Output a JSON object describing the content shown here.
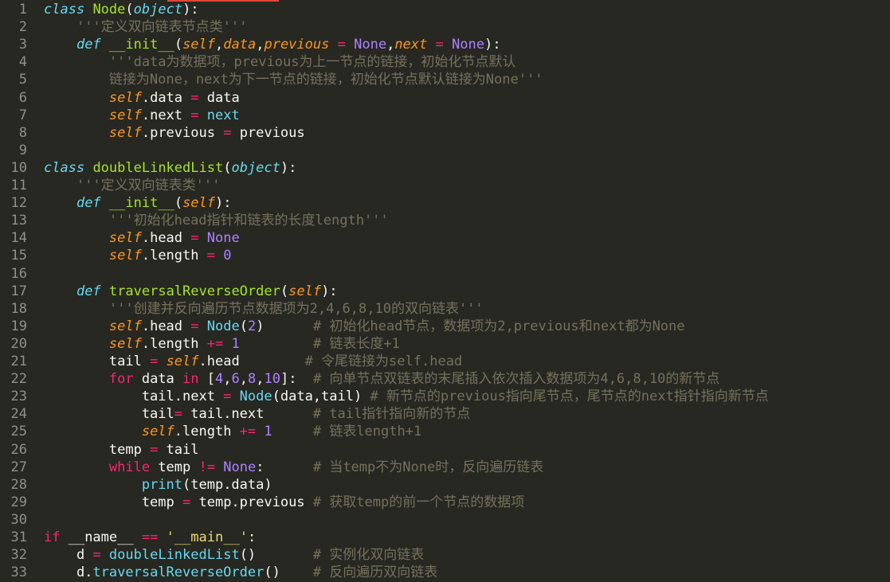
{
  "editor": {
    "lines": [
      {
        "n": "1",
        "tokens": [
          [
            "kw",
            "class"
          ],
          [
            "txt",
            " "
          ],
          [
            "cls",
            "Node"
          ],
          [
            "txt",
            "("
          ],
          [
            "kw",
            "object"
          ],
          [
            "txt",
            "):"
          ]
        ]
      },
      {
        "n": "2",
        "tokens": [
          [
            "txt",
            "    "
          ],
          [
            "doc",
            "'''定义双向链表节点类'''"
          ]
        ]
      },
      {
        "n": "3",
        "tokens": [
          [
            "txt",
            "    "
          ],
          [
            "kw",
            "def"
          ],
          [
            "txt",
            " "
          ],
          [
            "fn",
            "__init__"
          ],
          [
            "txt",
            "("
          ],
          [
            "arg",
            "self"
          ],
          [
            "txt",
            ","
          ],
          [
            "arg",
            "data"
          ],
          [
            "txt",
            ","
          ],
          [
            "arg",
            "previous"
          ],
          [
            "txt",
            " "
          ],
          [
            "op",
            "="
          ],
          [
            "txt",
            " "
          ],
          [
            "const",
            "None"
          ],
          [
            "txt",
            ","
          ],
          [
            "arg",
            "next"
          ],
          [
            "txt",
            " "
          ],
          [
            "op",
            "="
          ],
          [
            "txt",
            " "
          ],
          [
            "const",
            "None"
          ],
          [
            "txt",
            "):"
          ]
        ]
      },
      {
        "n": "4",
        "tokens": [
          [
            "txt",
            "        "
          ],
          [
            "doc",
            "'''data为数据项，previous为上一节点的链接，初始化节点默认"
          ]
        ]
      },
      {
        "n": "5",
        "tokens": [
          [
            "txt",
            "        "
          ],
          [
            "doc",
            "链接为None，next为下一节点的链接，初始化节点默认链接为None'''"
          ]
        ]
      },
      {
        "n": "6",
        "tokens": [
          [
            "txt",
            "        "
          ],
          [
            "slf",
            "self"
          ],
          [
            "txt",
            ".data "
          ],
          [
            "op",
            "="
          ],
          [
            "txt",
            " data"
          ]
        ]
      },
      {
        "n": "7",
        "tokens": [
          [
            "txt",
            "        "
          ],
          [
            "slf",
            "self"
          ],
          [
            "txt",
            ".next "
          ],
          [
            "op",
            "="
          ],
          [
            "txt",
            " "
          ],
          [
            "bi",
            "next"
          ]
        ]
      },
      {
        "n": "8",
        "tokens": [
          [
            "txt",
            "        "
          ],
          [
            "slf",
            "self"
          ],
          [
            "txt",
            ".previous "
          ],
          [
            "op",
            "="
          ],
          [
            "txt",
            " previous"
          ]
        ]
      },
      {
        "n": "9",
        "tokens": []
      },
      {
        "n": "10",
        "tokens": [
          [
            "kw",
            "class"
          ],
          [
            "txt",
            " "
          ],
          [
            "cls",
            "doubleLinkedList"
          ],
          [
            "txt",
            "("
          ],
          [
            "kw",
            "object"
          ],
          [
            "txt",
            "):"
          ]
        ]
      },
      {
        "n": "11",
        "tokens": [
          [
            "txt",
            "    "
          ],
          [
            "doc",
            "'''定义双向链表类'''"
          ]
        ]
      },
      {
        "n": "12",
        "tokens": [
          [
            "txt",
            "    "
          ],
          [
            "kw",
            "def"
          ],
          [
            "txt",
            " "
          ],
          [
            "fn",
            "__init__"
          ],
          [
            "txt",
            "("
          ],
          [
            "arg",
            "self"
          ],
          [
            "txt",
            "):"
          ]
        ]
      },
      {
        "n": "13",
        "tokens": [
          [
            "txt",
            "        "
          ],
          [
            "doc",
            "'''初始化head指针和链表的长度length'''"
          ]
        ]
      },
      {
        "n": "14",
        "tokens": [
          [
            "txt",
            "        "
          ],
          [
            "slf",
            "self"
          ],
          [
            "txt",
            ".head "
          ],
          [
            "op",
            "="
          ],
          [
            "txt",
            " "
          ],
          [
            "const",
            "None"
          ]
        ]
      },
      {
        "n": "15",
        "tokens": [
          [
            "txt",
            "        "
          ],
          [
            "slf",
            "self"
          ],
          [
            "txt",
            ".length "
          ],
          [
            "op",
            "="
          ],
          [
            "txt",
            " "
          ],
          [
            "num",
            "0"
          ]
        ]
      },
      {
        "n": "16",
        "tokens": []
      },
      {
        "n": "17",
        "tokens": [
          [
            "txt",
            "    "
          ],
          [
            "kw",
            "def"
          ],
          [
            "txt",
            " "
          ],
          [
            "fn",
            "traversalReverseOrder"
          ],
          [
            "txt",
            "("
          ],
          [
            "arg",
            "self"
          ],
          [
            "txt",
            "):"
          ]
        ]
      },
      {
        "n": "18",
        "tokens": [
          [
            "txt",
            "        "
          ],
          [
            "doc",
            "'''创建并反向遍历节点数据项为2,4,6,8,10的双向链表'''"
          ]
        ]
      },
      {
        "n": "19",
        "tokens": [
          [
            "txt",
            "        "
          ],
          [
            "slf",
            "self"
          ],
          [
            "txt",
            ".head "
          ],
          [
            "op",
            "="
          ],
          [
            "txt",
            " "
          ],
          [
            "bi",
            "Node"
          ],
          [
            "txt",
            "("
          ],
          [
            "num",
            "2"
          ],
          [
            "txt",
            ")      "
          ],
          [
            "cmt",
            "# 初始化head节点，数据项为2,previous和next都为None"
          ]
        ]
      },
      {
        "n": "20",
        "tokens": [
          [
            "txt",
            "        "
          ],
          [
            "slf",
            "self"
          ],
          [
            "txt",
            ".length "
          ],
          [
            "op",
            "+="
          ],
          [
            "txt",
            " "
          ],
          [
            "num",
            "1"
          ],
          [
            "txt",
            "         "
          ],
          [
            "cmt",
            "# 链表长度+1"
          ]
        ]
      },
      {
        "n": "21",
        "tokens": [
          [
            "txt",
            "        tail "
          ],
          [
            "op",
            "="
          ],
          [
            "txt",
            " "
          ],
          [
            "slf",
            "self"
          ],
          [
            "txt",
            ".head        "
          ],
          [
            "cmt",
            "# 令尾链接为self.head"
          ]
        ]
      },
      {
        "n": "22",
        "tokens": [
          [
            "txt",
            "        "
          ],
          [
            "kw2",
            "for"
          ],
          [
            "txt",
            " data "
          ],
          [
            "kw2",
            "in"
          ],
          [
            "txt",
            " ["
          ],
          [
            "num",
            "4"
          ],
          [
            "txt",
            ","
          ],
          [
            "num",
            "6"
          ],
          [
            "txt",
            ","
          ],
          [
            "num",
            "8"
          ],
          [
            "txt",
            ","
          ],
          [
            "num",
            "10"
          ],
          [
            "txt",
            "]:  "
          ],
          [
            "cmt",
            "# 向单节点双链表的末尾插入依次插入数据项为4,6,8,10的新节点"
          ]
        ]
      },
      {
        "n": "23",
        "tokens": [
          [
            "txt",
            "            tail.next "
          ],
          [
            "op",
            "="
          ],
          [
            "txt",
            " "
          ],
          [
            "bi",
            "Node"
          ],
          [
            "txt",
            "(data,tail) "
          ],
          [
            "cmt",
            "# 新节点的previous指向尾节点，尾节点的next指针指向新节点"
          ]
        ]
      },
      {
        "n": "24",
        "tokens": [
          [
            "txt",
            "            tail"
          ],
          [
            "op",
            "="
          ],
          [
            "txt",
            " tail.next      "
          ],
          [
            "cmt",
            "# tail指针指向新的节点"
          ]
        ]
      },
      {
        "n": "25",
        "tokens": [
          [
            "txt",
            "            "
          ],
          [
            "slf",
            "self"
          ],
          [
            "txt",
            ".length "
          ],
          [
            "op",
            "+="
          ],
          [
            "txt",
            " "
          ],
          [
            "num",
            "1"
          ],
          [
            "txt",
            "     "
          ],
          [
            "cmt",
            "# 链表length+1"
          ]
        ]
      },
      {
        "n": "26",
        "tokens": [
          [
            "txt",
            "        temp "
          ],
          [
            "op",
            "="
          ],
          [
            "txt",
            " tail"
          ]
        ]
      },
      {
        "n": "27",
        "tokens": [
          [
            "txt",
            "        "
          ],
          [
            "kw2",
            "while"
          ],
          [
            "txt",
            " temp "
          ],
          [
            "op",
            "!="
          ],
          [
            "txt",
            " "
          ],
          [
            "const",
            "None"
          ],
          [
            "txt",
            ":      "
          ],
          [
            "cmt",
            "# 当temp不为None时，反向遍历链表"
          ]
        ]
      },
      {
        "n": "28",
        "tokens": [
          [
            "txt",
            "            "
          ],
          [
            "bi",
            "print"
          ],
          [
            "txt",
            "(temp.data)"
          ]
        ]
      },
      {
        "n": "29",
        "tokens": [
          [
            "txt",
            "            temp "
          ],
          [
            "op",
            "="
          ],
          [
            "txt",
            " temp.previous "
          ],
          [
            "cmt",
            "# 获取temp的前一个节点的数据项"
          ]
        ]
      },
      {
        "n": "30",
        "tokens": []
      },
      {
        "n": "31",
        "tokens": [
          [
            "kw2",
            "if"
          ],
          [
            "txt",
            " __name__ "
          ],
          [
            "op",
            "=="
          ],
          [
            "txt",
            " "
          ],
          [
            "str",
            "'__main__'"
          ],
          [
            "txt",
            ":"
          ]
        ]
      },
      {
        "n": "32",
        "tokens": [
          [
            "txt",
            "    d "
          ],
          [
            "op",
            "="
          ],
          [
            "txt",
            " "
          ],
          [
            "bi",
            "doubleLinkedList"
          ],
          [
            "txt",
            "()       "
          ],
          [
            "cmt",
            "# 实例化双向链表"
          ]
        ]
      },
      {
        "n": "33",
        "tokens": [
          [
            "txt",
            "    d."
          ],
          [
            "bi",
            "traversalReverseOrder"
          ],
          [
            "txt",
            "()    "
          ],
          [
            "cmt",
            "# 反向遍历双向链表"
          ]
        ]
      }
    ]
  }
}
